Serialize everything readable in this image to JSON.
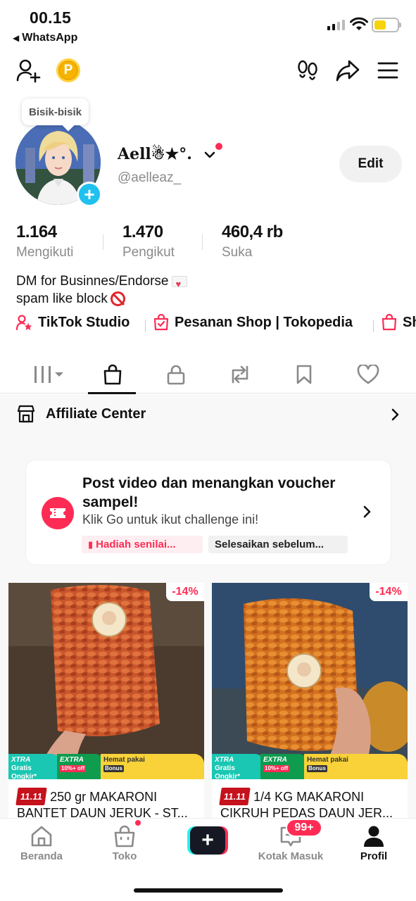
{
  "status_bar": {
    "time": "00.15",
    "back_app": "WhatsApp"
  },
  "profile": {
    "tooltip": "Bisik-bisik",
    "display_name": "Aell☃★°.",
    "handle": "@aelleaz_",
    "edit_label": "Edit",
    "stats": [
      {
        "value": "1.164",
        "label": "Mengikuti"
      },
      {
        "value": "1.470",
        "label": "Pengikut"
      },
      {
        "value": "460,4 rb",
        "label": "Suka"
      }
    ],
    "bio_lines": [
      "DM for Businnes/Endorse",
      "spam like block"
    ],
    "links": [
      {
        "label": "TikTok Studio",
        "icon": "person-star-icon"
      },
      {
        "label": "Pesanan Shop | Tokopedia",
        "icon": "order-bag-icon"
      },
      {
        "label": "Sh",
        "icon": "shop-bag-icon"
      }
    ]
  },
  "tabs": [
    {
      "name": "videos-grid",
      "icon": "grid-icon"
    },
    {
      "name": "shop",
      "icon": "bag-icon",
      "active": true
    },
    {
      "name": "private",
      "icon": "lock-icon"
    },
    {
      "name": "reposts",
      "icon": "repost-icon"
    },
    {
      "name": "saved",
      "icon": "bookmark-icon"
    },
    {
      "name": "liked",
      "icon": "heart-icon"
    }
  ],
  "affiliate": {
    "title": "Affiliate Center"
  },
  "challenge": {
    "title": "Post video dan menangkan voucher sampel!",
    "subtitle": "Klik Go untuk ikut challenge ini!",
    "chip_reward": "Hadiah senilai...",
    "chip_deadline": "Selesaikan sebelum..."
  },
  "products": [
    {
      "discount": "-14%",
      "promo": {
        "xtra": "XTRA",
        "free_shipping": "Gratis Ongkir*",
        "extra": "EXTRA",
        "extra_sub": "10%+ off",
        "hemat": "Hemat pakai",
        "bonus": "Bonus"
      },
      "tag": "11.11",
      "title": "250 gr MAKARONI BANTET DAUN JERUK - ST..."
    },
    {
      "discount": "-14%",
      "promo": {
        "xtra": "XTRA",
        "free_shipping": "Gratis Ongkir*",
        "extra": "EXTRA",
        "extra_sub": "10%+ off",
        "hemat": "Hemat pakai",
        "bonus": "Bonus"
      },
      "tag": "11.11",
      "title": "1/4 KG MAKARONI CIKRUH PEDAS DAUN JER..."
    }
  ],
  "bottom_nav": [
    {
      "label": "Beranda",
      "icon": "home-icon"
    },
    {
      "label": "Toko",
      "icon": "shop-icon"
    },
    {
      "label": "",
      "icon": "plus-icon"
    },
    {
      "label": "Kotak Masuk",
      "icon": "inbox-icon",
      "badge": "99+"
    },
    {
      "label": "Profil",
      "icon": "profile-icon",
      "active": true
    }
  ],
  "colors": {
    "accent": "#fe2c55",
    "cyan": "#25f4ee",
    "text": "#111111",
    "muted": "#8a8a8a"
  }
}
